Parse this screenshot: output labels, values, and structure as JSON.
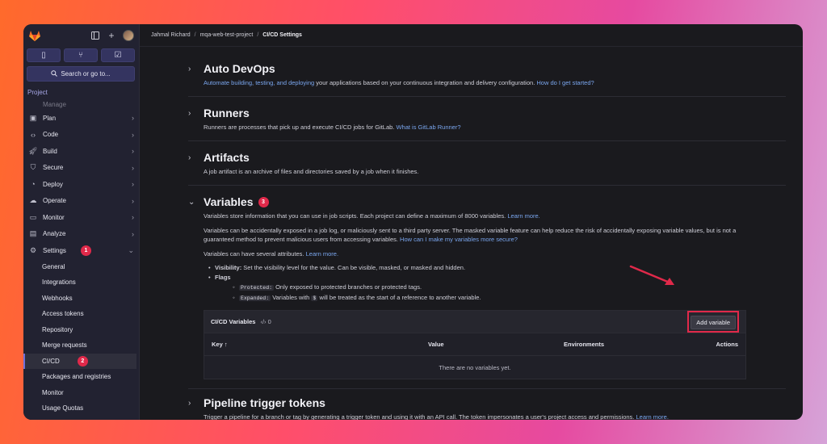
{
  "sidebar": {
    "search_label": "Search or go to...",
    "section_label": "Project",
    "manage_label": "Manage",
    "nav": [
      {
        "label": "Plan",
        "icon": "plan-icon"
      },
      {
        "label": "Code",
        "icon": "code-icon"
      },
      {
        "label": "Build",
        "icon": "build-icon"
      },
      {
        "label": "Secure",
        "icon": "shield-icon"
      },
      {
        "label": "Deploy",
        "icon": "deploy-icon"
      },
      {
        "label": "Operate",
        "icon": "operate-icon"
      },
      {
        "label": "Monitor",
        "icon": "monitor-icon"
      },
      {
        "label": "Analyze",
        "icon": "analyze-icon"
      },
      {
        "label": "Settings",
        "icon": "gear-icon",
        "badge": "1"
      }
    ],
    "settings_sub": [
      "General",
      "Integrations",
      "Webhooks",
      "Access tokens",
      "Repository",
      "Merge requests",
      "CI/CD",
      "Packages and registries",
      "Monitor",
      "Usage Quotas"
    ],
    "cicd_badge": "2"
  },
  "breadcrumb": {
    "user": "Jahmal Richard",
    "project": "mqa-web-test-project",
    "current": "CI/CD Settings"
  },
  "sections": {
    "autodevops": {
      "title": "Auto DevOps",
      "link1": "Automate building, testing, and deploying",
      "desc": " your applications based on your continuous integration and delivery configuration. ",
      "link2": "How do I get started?"
    },
    "runners": {
      "title": "Runners",
      "desc": "Runners are processes that pick up and execute CI/CD jobs for GitLab. ",
      "link": "What is GitLab Runner?"
    },
    "artifacts": {
      "title": "Artifacts",
      "desc": "A job artifact is an archive of files and directories saved by a job when it finishes."
    },
    "variables": {
      "title": "Variables",
      "badge": "3",
      "desc": "Variables store information that you can use in job scripts. Each project can define a maximum of 8000 variables. ",
      "desc_link": "Learn more.",
      "para2": "Variables can be accidentally exposed in a job log, or maliciously sent to a third party server. The masked variable feature can help reduce the risk of accidentally exposing variable values, but is not a guaranteed method to prevent malicious users from accessing variables. ",
      "para2_link": "How can I make my variables more secure?",
      "para3": "Variables can have several attributes. ",
      "para3_link": "Learn more.",
      "visibility_label": "Visibility:",
      "visibility_text": " Set the visibility level for the value. Can be visible, masked, or masked and hidden.",
      "flags_label": "Flags",
      "protected_code": "Protected:",
      "protected_text": " Only exposed to protected branches or protected tags.",
      "expanded_code": "Expanded:",
      "expanded_text_a": " Variables with ",
      "expanded_dollar": "$",
      "expanded_text_b": " will be treated as the start of a reference to another variable.",
      "table": {
        "title": "CI/CD Variables",
        "count": "0",
        "add_button": "Add variable",
        "col_key": "Key ↑",
        "col_value": "Value",
        "col_env": "Environments",
        "col_actions": "Actions",
        "empty": "There are no variables yet."
      }
    },
    "pipeline": {
      "title": "Pipeline trigger tokens",
      "desc": "Trigger a pipeline for a branch or tag by generating a trigger token and using it with an API call. The token impersonates a user's project access and permissions. ",
      "link": "Learn more."
    }
  },
  "colors": {
    "accent_red": "#e0294a",
    "link": "#7aa6ee",
    "sidebar_bg": "#222231"
  }
}
